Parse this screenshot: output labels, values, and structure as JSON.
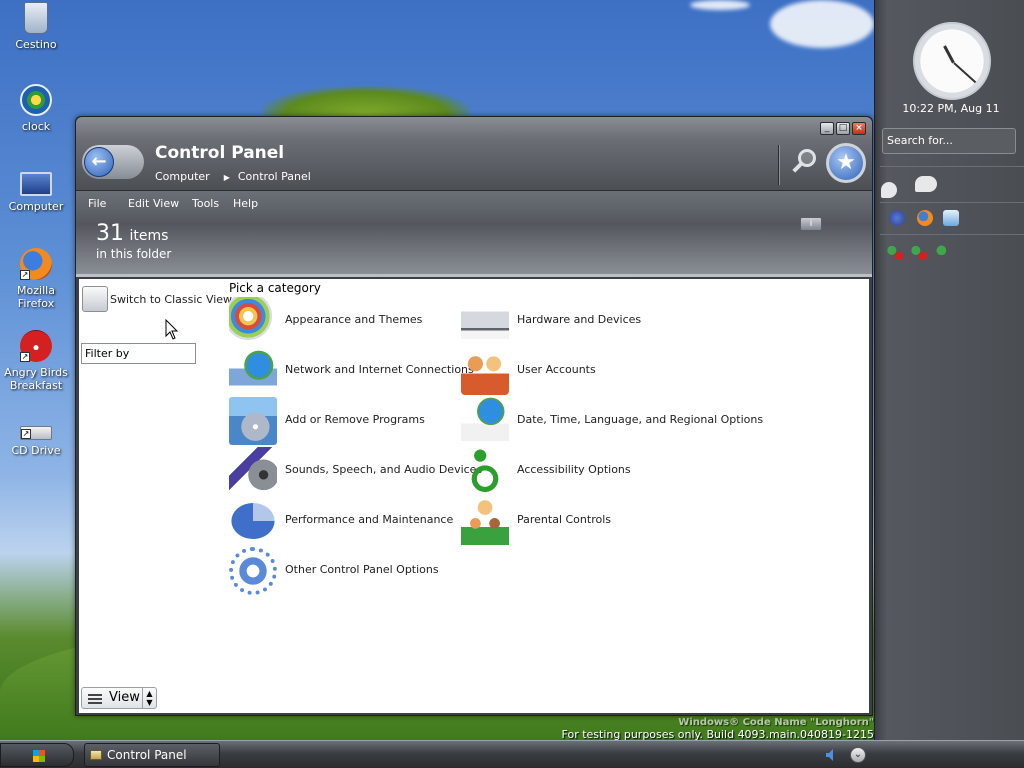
{
  "desktop": {
    "icons": [
      {
        "label": "Cestino",
        "icon": "recycle-bin-icon"
      },
      {
        "label": "clock",
        "icon": "media-player-icon"
      },
      {
        "label": "Computer",
        "icon": "computer-icon"
      },
      {
        "label": "Mozilla Firefox",
        "icon": "firefox-icon"
      },
      {
        "label": "Angry Birds Breakfast",
        "icon": "angry-birds-icon"
      },
      {
        "label": "CD Drive",
        "icon": "cd-drive-icon"
      }
    ],
    "watermark_line1": "Windows® Code Name \"Longhorn\"",
    "watermark_line2": "For testing purposes only. Build 4093.main.040819-1215"
  },
  "sidebar": {
    "clock_label": "10:22 PM, Aug 11",
    "search_placeholder": "Search for..."
  },
  "window": {
    "title": "Control Panel",
    "breadcrumb": [
      "Computer",
      "Control Panel"
    ],
    "menu": [
      "File",
      "Edit",
      "View",
      "Tools",
      "Help"
    ],
    "item_count": "31",
    "item_unit": "items",
    "item_sub": "in this folder",
    "tasks": {
      "classic_view": "Switch to Classic View",
      "filter_placeholder": "Filter by",
      "view_label": "View"
    },
    "pick_title": "Pick a category",
    "categories_left": [
      {
        "label": "Appearance and Themes",
        "icon": "appearance-icon"
      },
      {
        "label": "Network and Internet Connections",
        "icon": "network-icon"
      },
      {
        "label": "Add or Remove Programs",
        "icon": "add-remove-programs-icon"
      },
      {
        "label": "Sounds, Speech, and Audio Devices",
        "icon": "sounds-icon"
      },
      {
        "label": "Performance and Maintenance",
        "icon": "performance-icon"
      },
      {
        "label": "Other Control Panel Options",
        "icon": "gear-icon"
      }
    ],
    "categories_right": [
      {
        "label": "Hardware and Devices",
        "icon": "hardware-icon"
      },
      {
        "label": "User Accounts",
        "icon": "user-accounts-icon"
      },
      {
        "label": "Date, Time, Language, and Regional Options",
        "icon": "date-time-icon"
      },
      {
        "label": "Accessibility Options",
        "icon": "accessibility-icon"
      },
      {
        "label": "Parental Controls",
        "icon": "parental-controls-icon"
      }
    ]
  },
  "taskbar": {
    "task_label": "Control Panel"
  }
}
